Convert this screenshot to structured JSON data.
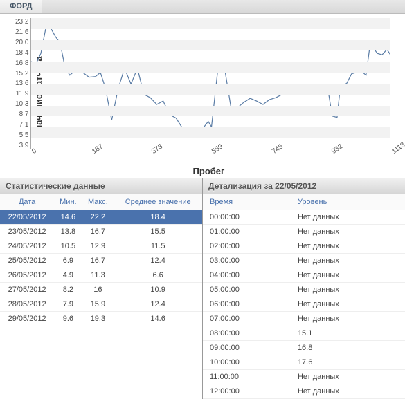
{
  "tab": "ФОРД",
  "chart": {
    "ylabel": "Значение датчика",
    "xlabel": "Пробег",
    "yticks": [
      "23.2",
      "21.6",
      "20.0",
      "18.4",
      "16.8",
      "15.2",
      "13.6",
      "11.9",
      "10.3",
      "8.7",
      "7.1",
      "5.5",
      "3.9"
    ],
    "xticks": [
      "0",
      "187",
      "373",
      "559",
      "745",
      "932",
      "1118"
    ]
  },
  "chart_data": {
    "type": "line",
    "title": "",
    "xlabel": "Пробег",
    "ylabel": "Значение датчика",
    "xlim": [
      0,
      1118
    ],
    "ylim": [
      3.9,
      23.2
    ],
    "x": [
      0,
      15,
      30,
      45,
      60,
      75,
      90,
      105,
      120,
      140,
      160,
      180,
      200,
      215,
      230,
      250,
      270,
      290,
      310,
      330,
      350,
      370,
      390,
      410,
      430,
      450,
      470,
      490,
      510,
      530,
      550,
      560,
      580,
      600,
      620,
      640,
      660,
      680,
      700,
      720,
      740,
      760,
      780,
      800,
      820,
      840,
      860,
      880,
      900,
      920,
      935,
      950,
      960,
      970,
      980,
      995,
      1010,
      1025,
      1040,
      1050,
      1060,
      1075,
      1090,
      1105,
      1118
    ],
    "y": [
      16.8,
      16.5,
      18.0,
      21.6,
      21.8,
      20.5,
      19.5,
      16.0,
      14.8,
      15.6,
      15.2,
      14.5,
      14.6,
      15.2,
      13.0,
      8.2,
      12.8,
      15.8,
      13.5,
      15.8,
      12.0,
      11.5,
      10.5,
      11.0,
      9.0,
      8.5,
      7.0,
      6.2,
      6.5,
      6.8,
      8.0,
      7.2,
      15.8,
      16.0,
      10.2,
      10.0,
      10.8,
      11.4,
      11.0,
      10.5,
      11.2,
      11.5,
      12.0,
      12.2,
      12.6,
      13.2,
      13.0,
      13.2,
      13.0,
      13.2,
      8.8,
      8.6,
      13.0,
      13.4,
      13.6,
      15.0,
      15.2,
      15.4,
      14.8,
      18.4,
      19.0,
      18.0,
      17.8,
      18.6,
      17.6
    ]
  },
  "stats": {
    "title": "Статистические данные",
    "headers": [
      "Дата",
      "Мин.",
      "Макс.",
      "Среднее значение"
    ],
    "rows": [
      [
        "22/05/2012",
        "14.6",
        "22.2",
        "18.4"
      ],
      [
        "23/05/2012",
        "13.8",
        "16.7",
        "15.5"
      ],
      [
        "24/05/2012",
        "10.5",
        "12.9",
        "11.5"
      ],
      [
        "25/05/2012",
        "6.9",
        "16.7",
        "12.4"
      ],
      [
        "26/05/2012",
        "4.9",
        "11.3",
        "6.6"
      ],
      [
        "27/05/2012",
        "8.2",
        "16",
        "10.9"
      ],
      [
        "28/05/2012",
        "7.9",
        "15.9",
        "12.4"
      ],
      [
        "29/05/2012",
        "9.6",
        "19.3",
        "14.6"
      ]
    ],
    "selected": 0
  },
  "detail": {
    "title": "Детализация за 22/05/2012",
    "headers": [
      "Время",
      "Уровень"
    ],
    "rows": [
      [
        "00:00:00",
        "Нет данных"
      ],
      [
        "01:00:00",
        "Нет данных"
      ],
      [
        "02:00:00",
        "Нет данных"
      ],
      [
        "03:00:00",
        "Нет данных"
      ],
      [
        "04:00:00",
        "Нет данных"
      ],
      [
        "05:00:00",
        "Нет данных"
      ],
      [
        "06:00:00",
        "Нет данных"
      ],
      [
        "07:00:00",
        "Нет данных"
      ],
      [
        "08:00:00",
        "15.1"
      ],
      [
        "09:00:00",
        "16.8"
      ],
      [
        "10:00:00",
        "17.6"
      ],
      [
        "11:00:00",
        "Нет данных"
      ],
      [
        "12:00:00",
        "Нет данных"
      ]
    ]
  }
}
